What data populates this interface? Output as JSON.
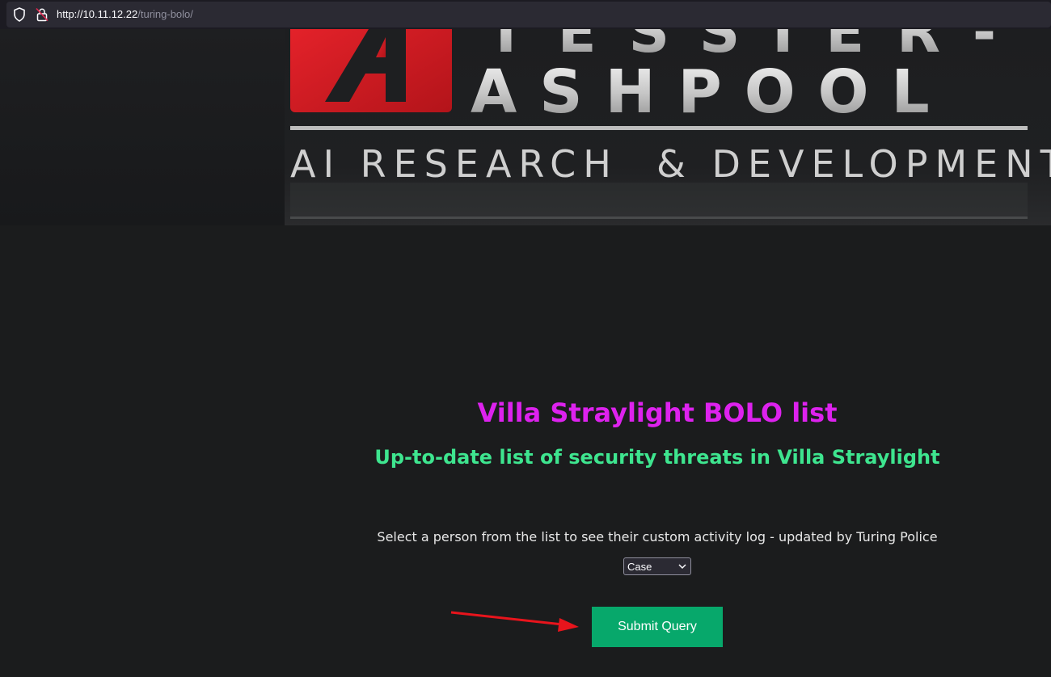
{
  "browser": {
    "url_host": "http://10.11.12.22",
    "url_path": "/turing-bolo/"
  },
  "banner": {
    "logo_line1": "TESSIER-",
    "logo_line2": "ASHPOOL",
    "logo_tagline": "AI RESEARCH  & DEVELOPMENT",
    "logo_mark": "A"
  },
  "main": {
    "title": "Villa Straylight BOLO list",
    "subtitle": "Up-to-date list of security threats in Villa Straylight",
    "instructions": "Select a person from the list to see their custom activity log - updated by Turing Police",
    "select_value": "Case",
    "submit_label": "Submit Query"
  },
  "colors": {
    "title": "#dd22ee",
    "subtitle": "#3ee58f",
    "button": "#07a86b",
    "annotation_arrow": "#e8141c"
  }
}
